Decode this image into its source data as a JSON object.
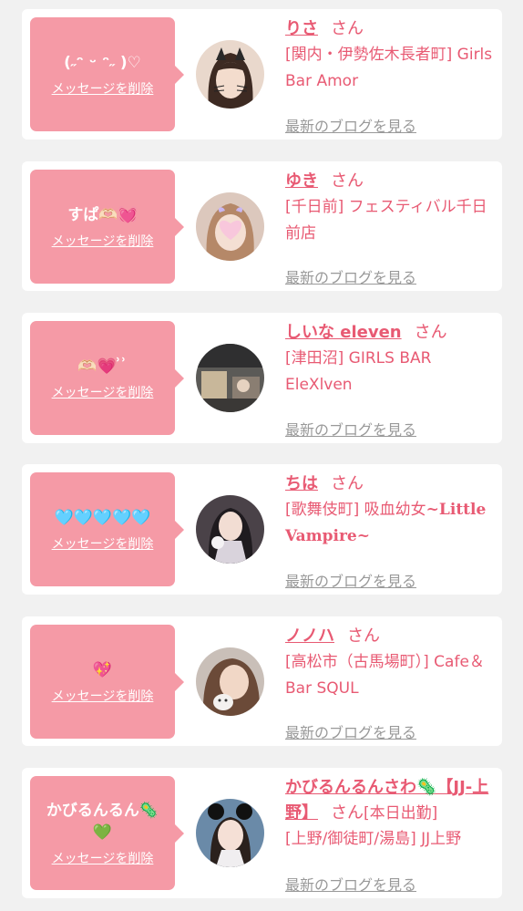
{
  "colors": {
    "background": "#f1f1f1",
    "card": "#ffffff",
    "bubble": "#f59aa6",
    "accent": "#e85a73",
    "link_gray": "#999999"
  },
  "labels": {
    "delete": "メッセージを削除",
    "blog": "最新のブログを見る",
    "suffix": "さん"
  },
  "cards": [
    {
      "message": "(˶ᵔ ᵕ ᵔ˶ )♡",
      "name": "りさ",
      "shop": "[関内・伊勢佐木長者町] Girls Bar Amor",
      "avatar": "cat-filter-photo"
    },
    {
      "message": "すぱ🫶🏻💓",
      "name": "ゆき",
      "shop": "[千日前] フェスティバル千日前店",
      "avatar": "heart-sticker-photo"
    },
    {
      "message": "🫶🏻💗 ͗ ͗",
      "name": "しいな eleven",
      "shop": "[津田沼] GIRLS BAR EleXlven",
      "avatar": "bar-interior-photo"
    },
    {
      "message": "🩵🩵🩵🩵🩵",
      "name": "ちは",
      "shop_prefix": "[歌舞伎町] 吸血幼女",
      "shop_suffix": "~Little Vampire~",
      "avatar": "dark-outfit-photo"
    },
    {
      "message": "💖",
      "name": "ノノハ",
      "shop": "[高松市（古馬場町）] Cafe＆Bar SQUL",
      "avatar": "selfie-sticker-photo"
    },
    {
      "message": "かびるんるん🦠💚",
      "name": "かびるんるんさわ🦠【JJ-上野】",
      "status": "[本日出勤]",
      "shop": "[上野/御徒町/湯島] JJ上野",
      "avatar": "mouse-ears-photo"
    }
  ]
}
